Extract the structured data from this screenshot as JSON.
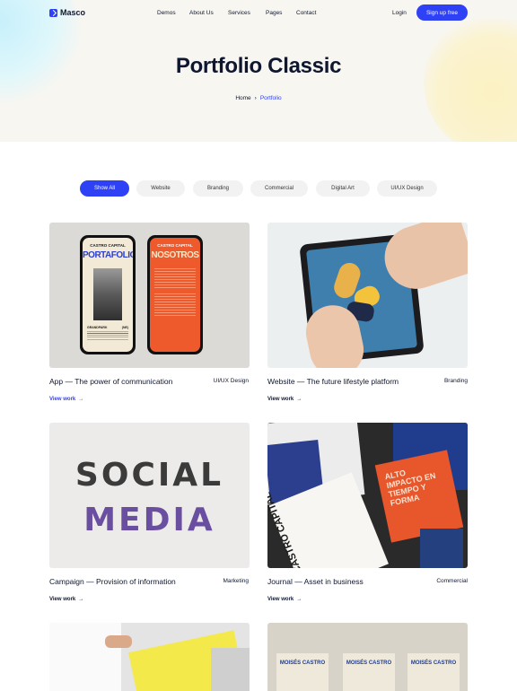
{
  "brand": {
    "name": "Masco"
  },
  "nav": {
    "items": [
      "Demos",
      "About Us",
      "Services",
      "Pages",
      "Contact"
    ],
    "login": "Login",
    "signup": "Sign up free"
  },
  "hero": {
    "title": "Portfolio Classic",
    "breadcrumb": {
      "home": "Home",
      "separator": "›",
      "current": "Portfolio"
    }
  },
  "filters": [
    {
      "label": "Show All",
      "active": true
    },
    {
      "label": "Website",
      "active": false
    },
    {
      "label": "Branding",
      "active": false
    },
    {
      "label": "Commercial",
      "active": false
    },
    {
      "label": "Digital Art",
      "active": false
    },
    {
      "label": "UI/UX Design",
      "active": false
    }
  ],
  "projects": [
    {
      "title": "App — The power of communication",
      "category": "UI/UX Design",
      "link": "View work"
    },
    {
      "title": "Website — The future lifestyle platform",
      "category": "Branding",
      "link": "View work"
    },
    {
      "title": "Campaign — Provision of  information",
      "category": "Marketing",
      "link": "View work"
    },
    {
      "title": "Journal — Asset in business",
      "category": "Commercial",
      "link": "View work"
    }
  ],
  "thumbnails": {
    "app": {
      "left_brand": "CASTRO CAPITAL",
      "left_headline": "PORTAFOLIO",
      "left_footer": "GRANDPARK",
      "left_tag": "(NE)",
      "right_brand": "CASTRO CAPITAL",
      "right_headline": "NOSOTROS"
    },
    "social": {
      "line1": "SOCIAL",
      "line2": "MEDIA"
    },
    "journal": {
      "spine": "CASTRO CAPITAL",
      "cover": "ALTO IMPACTO EN TIEMPO Y FORMA"
    },
    "moises": {
      "label": "MOISÉS CASTRO"
    }
  },
  "colors": {
    "accent": "#2f41f4",
    "text": "#0f1730",
    "hero_bg": "#f8f6f1"
  }
}
